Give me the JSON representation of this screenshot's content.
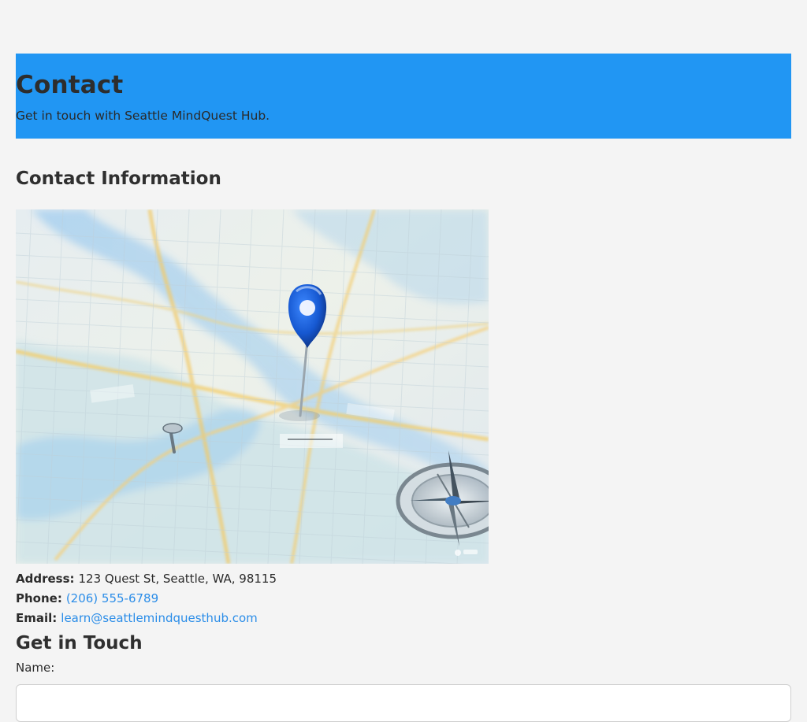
{
  "hero": {
    "title": "Contact",
    "subtitle": "Get in touch with Seattle MindQuest Hub."
  },
  "contact_info": {
    "heading": "Contact Information",
    "map_image_alt": "Map with location pin",
    "address_label": "Address:",
    "address_value": "123 Quest St, Seattle, WA, 98115",
    "phone_label": "Phone:",
    "phone_value": "(206) 555-6789",
    "email_label": "Email:",
    "email_value": "learn@seattlemindquesthub.com"
  },
  "form": {
    "heading": "Get in Touch",
    "name_label": "Name:",
    "name_value": "",
    "name_placeholder": ""
  },
  "colors": {
    "hero_background": "#2196f3",
    "link": "#2b8de8",
    "page_background": "#f4f4f4",
    "pin": "#1f5ec9"
  },
  "icons": {
    "map_pin": "location-pin-icon",
    "compass": "compass-icon"
  }
}
